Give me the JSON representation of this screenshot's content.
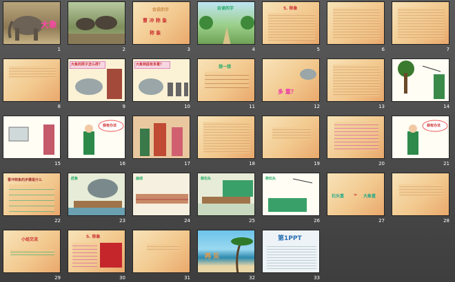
{
  "slides": [
    {
      "n": "1",
      "title": "大象"
    },
    {
      "n": "2"
    },
    {
      "n": "3",
      "header": "会说的字",
      "line1": "曹 冲 称 象",
      "line2": "称 象"
    },
    {
      "n": "4",
      "header": "会读的字"
    },
    {
      "n": "5",
      "title": "5. 称象"
    },
    {
      "n": "6"
    },
    {
      "n": "7"
    },
    {
      "n": "8"
    },
    {
      "n": "9",
      "caption": "大象的样子怎么样？"
    },
    {
      "n": "10",
      "caption": "大象到底有多重？"
    },
    {
      "n": "11",
      "header": "想一想"
    },
    {
      "n": "12",
      "word": "多 重？"
    },
    {
      "n": "13"
    },
    {
      "n": "14"
    },
    {
      "n": "15"
    },
    {
      "n": "16",
      "bubble": "我有办法"
    },
    {
      "n": "17"
    },
    {
      "n": "18"
    },
    {
      "n": "19"
    },
    {
      "n": "20"
    },
    {
      "n": "21",
      "bubble": "我有办法"
    },
    {
      "n": "22",
      "title": "曹冲称象的步骤是什么"
    },
    {
      "n": "23",
      "label": "赶象"
    },
    {
      "n": "24",
      "label": "画线"
    },
    {
      "n": "25",
      "label": "装石头"
    },
    {
      "n": "26",
      "label": "称石头"
    },
    {
      "n": "27",
      "left": "石头重",
      "right": "大象重"
    },
    {
      "n": "28"
    },
    {
      "n": "29",
      "title": "小组交流"
    },
    {
      "n": "30",
      "title": "5. 称象"
    },
    {
      "n": "31"
    },
    {
      "n": "32",
      "label": "再 见"
    },
    {
      "n": "33",
      "brand": "第1PPT"
    }
  ]
}
